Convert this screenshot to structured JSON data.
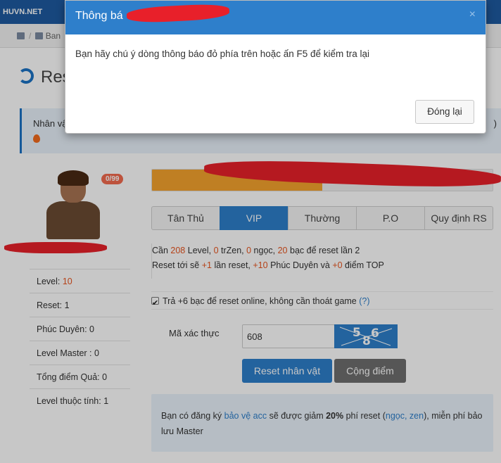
{
  "site": {
    "logo_text": "HUVN.NET"
  },
  "breadcrumb": {
    "item": "Ban"
  },
  "page": {
    "title": "Res"
  },
  "notice": {
    "text": "Nhân vậ",
    "tail": ")"
  },
  "character": {
    "badge": "0/99",
    "stats": [
      {
        "label": "Level: ",
        "value": "10",
        "highlight": true
      },
      {
        "label": "Reset: ",
        "value": "1",
        "highlight": false
      },
      {
        "label": "Phúc Duyên: ",
        "value": "0",
        "highlight": false
      },
      {
        "label": "Level Master : ",
        "value": "0",
        "highlight": false
      },
      {
        "label": "Tổng điểm Quả: ",
        "value": "0",
        "highlight": false
      },
      {
        "label": "Level thuộc tính: ",
        "value": "1",
        "highlight": false
      }
    ]
  },
  "progress": {
    "fraction": 0.5
  },
  "tabs": [
    {
      "label": "Tân Thủ",
      "active": false
    },
    {
      "label": "VIP",
      "active": true
    },
    {
      "label": "Thường",
      "active": false
    },
    {
      "label": "P.O",
      "active": false
    },
    {
      "label": "Quy định RS",
      "active": false
    }
  ],
  "requirements": {
    "line1": {
      "p1": "Cần ",
      "level": "208",
      "p2": " Level, ",
      "zen": "0",
      "p3": " trZen, ",
      "ngoc": "0",
      "p4": " ngọc, ",
      "bac": "20",
      "p5": " bạc để reset lần 2"
    },
    "line2": {
      "p1": "Reset tới sẽ ",
      "resets": "+1",
      "p2": " lần reset, ",
      "phuc": "+10",
      "p3": " Phúc Duyên và ",
      "top": "+0",
      "p4": " điểm TOP"
    }
  },
  "online_option": {
    "label": "Trả +6 bạc để reset online, không cần thoát game ",
    "help": "(?)",
    "checked": true
  },
  "captcha": {
    "label": "Mã xác thực",
    "value": "608",
    "image_text": [
      "5",
      "8",
      "6"
    ]
  },
  "buttons": {
    "reset": "Reset nhân vật",
    "add_points": "Cộng điểm"
  },
  "footer": {
    "p1": "Bạn có đăng ký ",
    "link": "bảo vệ acc",
    "p2": " sẽ được giảm ",
    "discount": "20%",
    "p3": " phí reset (",
    "items": "ngọc, zen",
    "p4": "), miễn phí bảo lưu Master"
  },
  "modal": {
    "title": "Thông bá",
    "close_symbol": "×",
    "body": "Bạn hãy chú ý dòng thông báo đỏ phía trên hoặc ấn F5 để kiểm tra lại",
    "close_button": "Đóng lại"
  },
  "colors": {
    "primary": "#2e7fcb",
    "accent": "#e8541e",
    "redaction": "#e8202a"
  }
}
